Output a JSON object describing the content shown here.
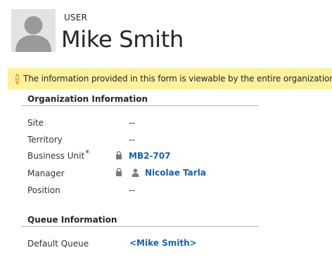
{
  "header": {
    "entity_type": "USER",
    "record_name": "Mike Smith"
  },
  "notification": {
    "icon": "warning-icon",
    "text": "The information provided in this form is viewable by the entire organization."
  },
  "sections": {
    "organization": {
      "title": "Organization Information",
      "rows": {
        "site": {
          "label": "Site",
          "value": "--"
        },
        "territory": {
          "label": "Territory",
          "value": "--"
        },
        "business_unit": {
          "label": "Business Unit",
          "required_mark": "*",
          "value": "MB2-707",
          "locked": true
        },
        "manager": {
          "label": "Manager",
          "value": "Nicolae Tarla",
          "locked": true
        },
        "position": {
          "label": "Position",
          "value": "--"
        }
      }
    },
    "queue": {
      "title": "Queue Information",
      "rows": {
        "default_queue": {
          "label": "Default Queue",
          "value": "<Mike Smith>"
        }
      }
    }
  },
  "colors": {
    "link": "#1160b7",
    "notification_bg": "#fff19d",
    "warning_icon": "#e8a317",
    "required": "#c00000",
    "rule": "#b3b3b3"
  }
}
